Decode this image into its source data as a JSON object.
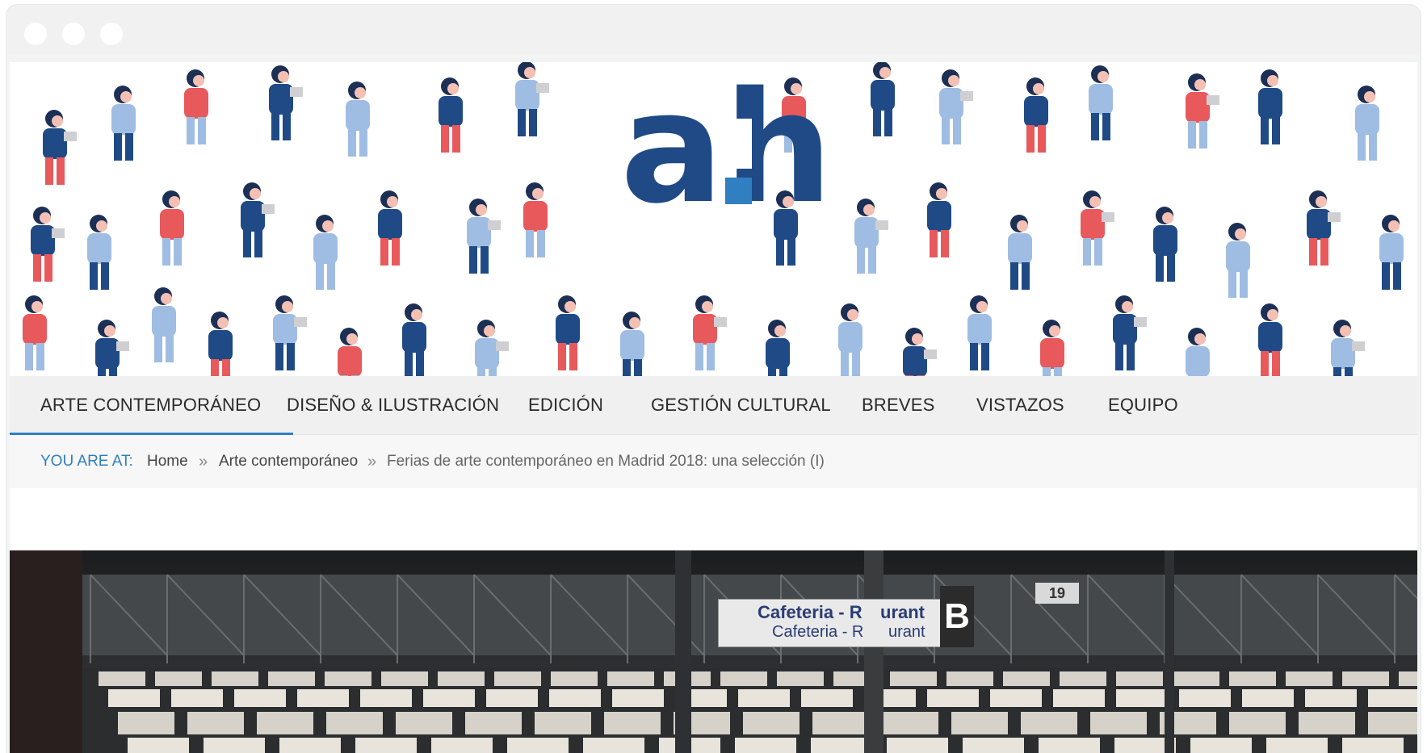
{
  "window": {
    "dots": 3
  },
  "banner": {
    "logo_main": "ah",
    "colors": {
      "navy": "#1f4a86",
      "light_blue": "#9fbde3",
      "coral": "#e8595c",
      "skin": "#f4c0b4",
      "grey": "#cfcfd3"
    }
  },
  "nav": {
    "items": [
      {
        "label": "ARTE CONTEMPORÁNEO",
        "active": true
      },
      {
        "label": "DISEÑO & ILUSTRACIÓN",
        "active": false
      },
      {
        "label": "EDICIÓN",
        "active": false
      },
      {
        "label": "GESTIÓN CULTURAL",
        "active": false
      },
      {
        "label": "BREVES",
        "active": false
      },
      {
        "label": "VISTAZOS",
        "active": false
      },
      {
        "label": "EQUIPO",
        "active": false
      }
    ],
    "accent": "#2f7fc1"
  },
  "breadcrumb": {
    "label": "YOU ARE AT:",
    "separator": "»",
    "items": [
      "Home",
      "Arte contemporáneo",
      "Ferias de arte contemporáneo en Madrid 2018: una selección (I)"
    ]
  },
  "hero_photo": {
    "sign_line1": "Cafeteria - R",
    "sign_line1b": "urant",
    "sign_line2": "Cafeteria - R",
    "sign_line2b": "urant",
    "sign_letter": "B",
    "sign_number": "19"
  }
}
